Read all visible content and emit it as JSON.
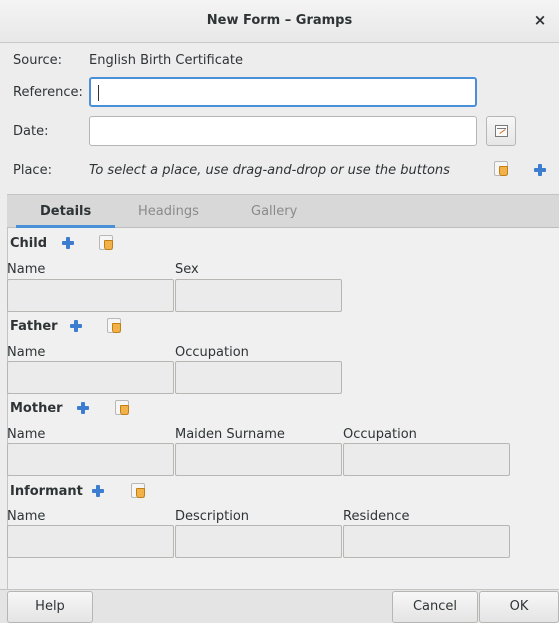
{
  "window": {
    "title": "New Form – Gramps",
    "close_glyph": "×"
  },
  "header": {
    "source_label": "Source:",
    "source_value": "English Birth Certificate",
    "reference_label": "Reference:",
    "reference_value": "",
    "date_label": "Date:",
    "date_value": "",
    "place_label": "Place:",
    "place_hint": "To select a place, use drag-and-drop or use the buttons"
  },
  "tabs": [
    {
      "label": "Details",
      "active": true
    },
    {
      "label": "Headings",
      "active": false
    },
    {
      "label": "Gallery",
      "active": false
    }
  ],
  "sections": {
    "child": {
      "title": "Child",
      "columns": [
        "Name",
        "Sex"
      ]
    },
    "father": {
      "title": "Father",
      "columns": [
        "Name",
        "Occupation"
      ]
    },
    "mother": {
      "title": "Mother",
      "columns": [
        "Name",
        "Maiden Surname",
        "Occupation"
      ]
    },
    "informant": {
      "title": "Informant",
      "columns": [
        "Name",
        "Description",
        "Residence"
      ]
    }
  },
  "buttons": {
    "help": "Help",
    "cancel": "Cancel",
    "ok": "OK"
  },
  "icons": {
    "add": "add-icon",
    "share": "share-existing-icon",
    "date_editor": "date-editor-icon"
  },
  "colors": {
    "accent": "#4a90d9",
    "add_icon": "#3c7dd0"
  }
}
